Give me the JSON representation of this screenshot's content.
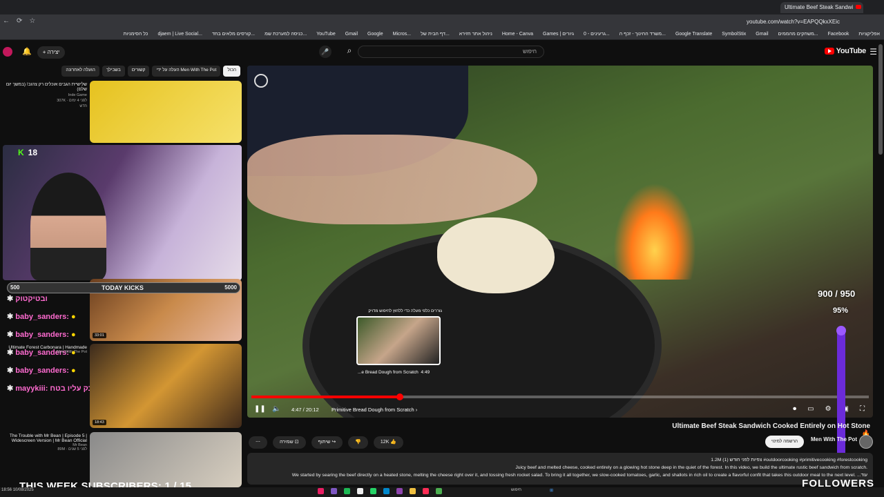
{
  "browser": {
    "tab_title": "Ultimate Beef Steak Sandwi",
    "url": "youtube.com/watch?v=EAPQQkxXEic",
    "bookmarks": [
      "אפליקציות",
      "Facebook",
      "משחקים מהממים...",
      "Gmail",
      "SymbolStix",
      "Google Translate",
      "משרד החינוך - זכף ה...",
      "גרעינים - 0...",
      "Games | גיורים",
      "Home - Canva",
      "ניהול אתר חזירא",
      "דף הבית של...",
      "Micros...",
      "Google",
      "Gmail",
      "YouTube",
      "כניסה למערכת שמ...",
      "קורסים מלאים בחד...",
      "djaem | Live Social...",
      "כל הסימניות"
    ]
  },
  "header": {
    "logo_text": "YouTube",
    "search_placeholder": "חיפוש",
    "create_label": "יצירה"
  },
  "player": {
    "preview_caption": "גוררים כלפי מעלה כדי ללחוץ לחיפוש מדויק",
    "preview_chapter": "...e Bread Dough from Scratch",
    "preview_time": "4:49",
    "time_label": "4:47 / 20:12",
    "chapter_label": "Primitive Bread Dough from Scratch",
    "progress_fraction": 0.24
  },
  "video": {
    "title": "Ultimate Beef Steak Sandwich Cooked Entirely on Hot Stone",
    "channel": "Men With The Pot",
    "subscribe_label": "הרשמה למינוי",
    "actions": {
      "like_count": "12K",
      "share_label": "שיתוף",
      "save_label": "שמירה"
    },
    "desc_meta": "1.2M צפיות לפני חודש (1)  #outdoorcooking #primitivecooking #forestcooking",
    "desc_line1": "Juicy beef and melted cheese, cooked entirely on a glowing hot stone deep in the quiet of the forest. In this video, we build the ultimate rustic beef sandwich from scratch.",
    "desc_line2": "We started by searing the beef directly on a heated stone, melting the cheese right over it, and tossing fresh rocket salad. To bring it all together, we slow-cooked tomatoes, garlic, and shallots in rich oil to create a flavorful confit that takes this outdoor meal to the next level. ...עוד"
  },
  "chips": [
    "הכול",
    "העלה על ידי Men With The Pot",
    "קשורים",
    "בשבילך",
    "הועלה לאחרונה"
  ],
  "recs": [
    {
      "title": "שלישיית הגבים אוכלים רק צהוב! (במשך יום שלם)",
      "channel": "Inde Game",
      "meta": "307K · לפני 4 ימים",
      "badge": "חדש"
    },
    {
      "title": "Ultimate Forest Carbonara | Handmade",
      "channel": "Men With The Pot",
      "duration": "18:43"
    },
    {
      "title": "The Trouble with Mr Bean | Episode 5 | Widescreen Version | Mr Bean Official",
      "channel": "Mr Bean",
      "meta": "89M · לפני 5 שנים"
    }
  ],
  "rec_duration_2": "33:01",
  "stream": {
    "kick_count": "18",
    "goal_start": "500",
    "goal_label": "TODAY KICKS",
    "goal_end": "5000",
    "chat": [
      {
        "user": "ובטיקטוק",
        "emoji": ""
      },
      {
        "user": "baby_sanders:",
        "emoji": "●"
      },
      {
        "user": "baby_sanders:",
        "emoji": "●"
      },
      {
        "user": "baby_sanders:",
        "emoji": "●"
      },
      {
        "user": "baby_sanders:",
        "emoji": "●"
      },
      {
        "user": "mayykiii: איזה ריח נדבק עליו בטח",
        "emoji": ""
      }
    ],
    "counter": "900 / 950",
    "percent": "95%",
    "weekly": "THIS WEEK SUBSCRIBERS: 1 / 15",
    "followers": "FOLLOWERS"
  },
  "taskbar": {
    "time": "18:56",
    "date": "10/08/2025",
    "search": "חיפוש"
  }
}
